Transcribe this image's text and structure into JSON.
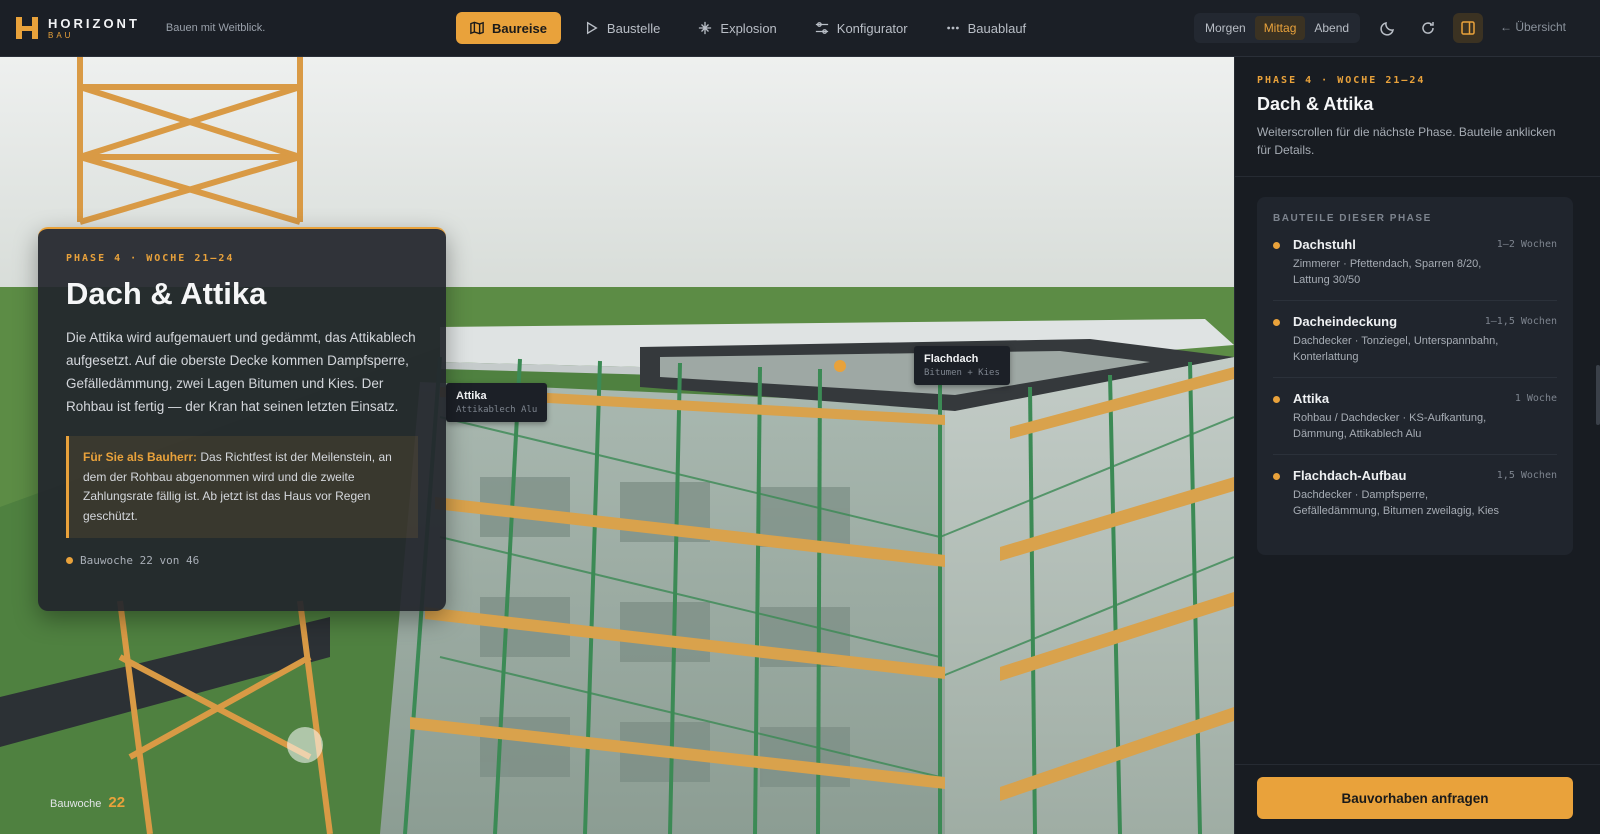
{
  "brand": {
    "name": "HORIZONT",
    "sub": "BAU",
    "tagline": "Bauen mit Weitblick."
  },
  "nav": [
    {
      "label": "Baureise",
      "icon": "map-icon",
      "active": true
    },
    {
      "label": "Baustelle",
      "icon": "play-icon",
      "active": false
    },
    {
      "label": "Explosion",
      "icon": "sparkle-icon",
      "active": false
    },
    {
      "label": "Konfigurator",
      "icon": "sliders-icon",
      "active": false
    },
    {
      "label": "Bauablauf",
      "icon": "dots-icon",
      "active": false
    }
  ],
  "time_of_day": {
    "options": [
      "Morgen",
      "Mittag",
      "Abend"
    ],
    "selected": "Mittag"
  },
  "toolbar": {
    "overview_label": "← Übersicht"
  },
  "scene": {
    "labels": [
      {
        "title": "Flachdach",
        "sub": "Bitumen + Kies"
      },
      {
        "title": "Attika",
        "sub": "Attikablech Alu"
      }
    ]
  },
  "card": {
    "phase": "PHASE 4 · WOCHE 21–24",
    "title": "Dach & Attika",
    "body": "Die Attika wird aufgemauert und gedämmt, das Attikablech aufgesetzt. Auf die oberste Decke kommen Dampfsperre, Gefälledämmung, zwei Lagen Bitumen und Kies. Der Rohbau ist fertig — der Kran hat seinen letzten Einsatz.",
    "note_label": "Für Sie als Bauherr:",
    "note_text": " Das Richtfest ist der Meilenstein, an dem der Rohbau abgenommen wird und die zweite Zahlungsrate fällig ist. Ab jetzt ist das Haus vor Regen geschützt.",
    "week_text": "Bauwoche 22 von 46"
  },
  "week_counter": {
    "label": "Bauwoche",
    "value": "22"
  },
  "sidebar": {
    "phase": "PHASE 4 · WOCHE 21–24",
    "title": "Dach & Attika",
    "hint": "Weiterscrollen für die nächste Phase. Bauteile anklicken für Details.",
    "parts_heading": "BAUTEILE DIESER PHASE",
    "parts": [
      {
        "name": "Dachstuhl",
        "duration": "1–2 Wochen",
        "desc": "Zimmerer · Pfettendach, Sparren 8/20, Lattung 30/50"
      },
      {
        "name": "Dacheindeckung",
        "duration": "1–1,5 Wochen",
        "desc": "Dachdecker · Tonziegel, Unterspannbahn, Konterlattung"
      },
      {
        "name": "Attika",
        "duration": "1 Woche",
        "desc": "Rohbau / Dachdecker · KS-Aufkantung, Dämmung, Attikablech Alu"
      },
      {
        "name": "Flachdach-Aufbau",
        "duration": "1,5 Wochen",
        "desc": "Dachdecker · Dampfsperre, Gefälledämmung, Bitumen zweilagig, Kies"
      }
    ],
    "cta": "Bauvorhaben anfragen"
  },
  "colors": {
    "accent": "#e9a23b",
    "bg": "#181c22",
    "topbar": "#1b1f26"
  }
}
